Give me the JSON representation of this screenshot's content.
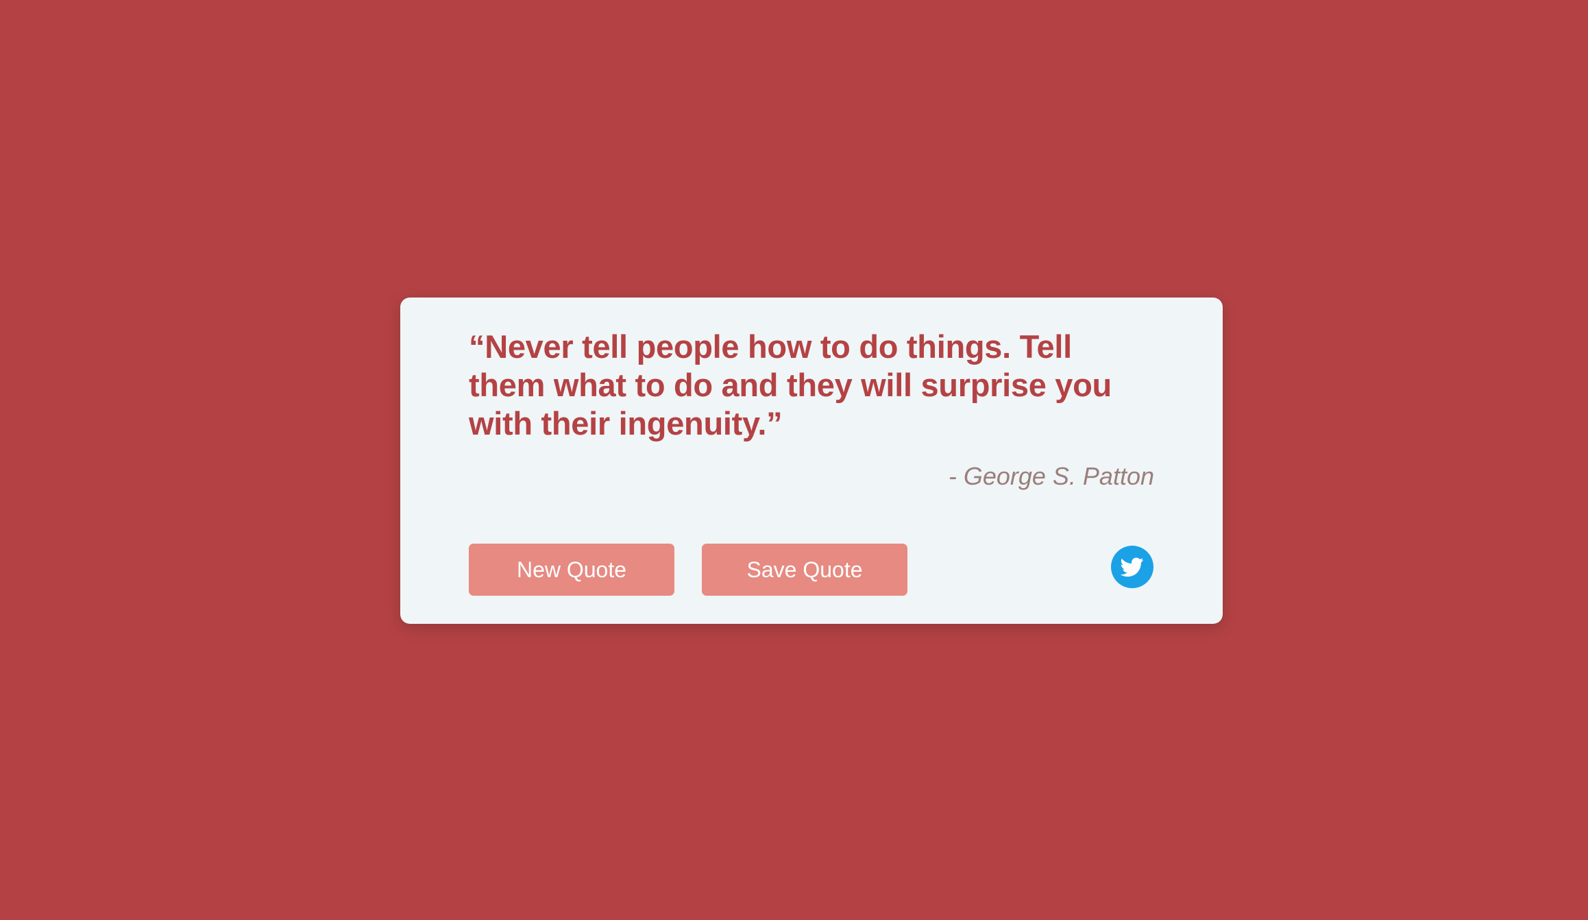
{
  "page": {
    "background_color": "#b44244"
  },
  "quote": {
    "text": "“Never tell people how to do things. Tell them what to do and they will surprise you with their ingenuity.”",
    "author": "- George S. Patton"
  },
  "actions": {
    "new_quote_label": "New Quote",
    "save_quote_label": "Save Quote",
    "tweet_icon": "twitter-icon"
  },
  "colors": {
    "card": "#f0f5f7",
    "accent": "#b44244",
    "button": "#e68a82",
    "twitter": "#1ba1e6",
    "author_text": "#9a7f7a"
  }
}
